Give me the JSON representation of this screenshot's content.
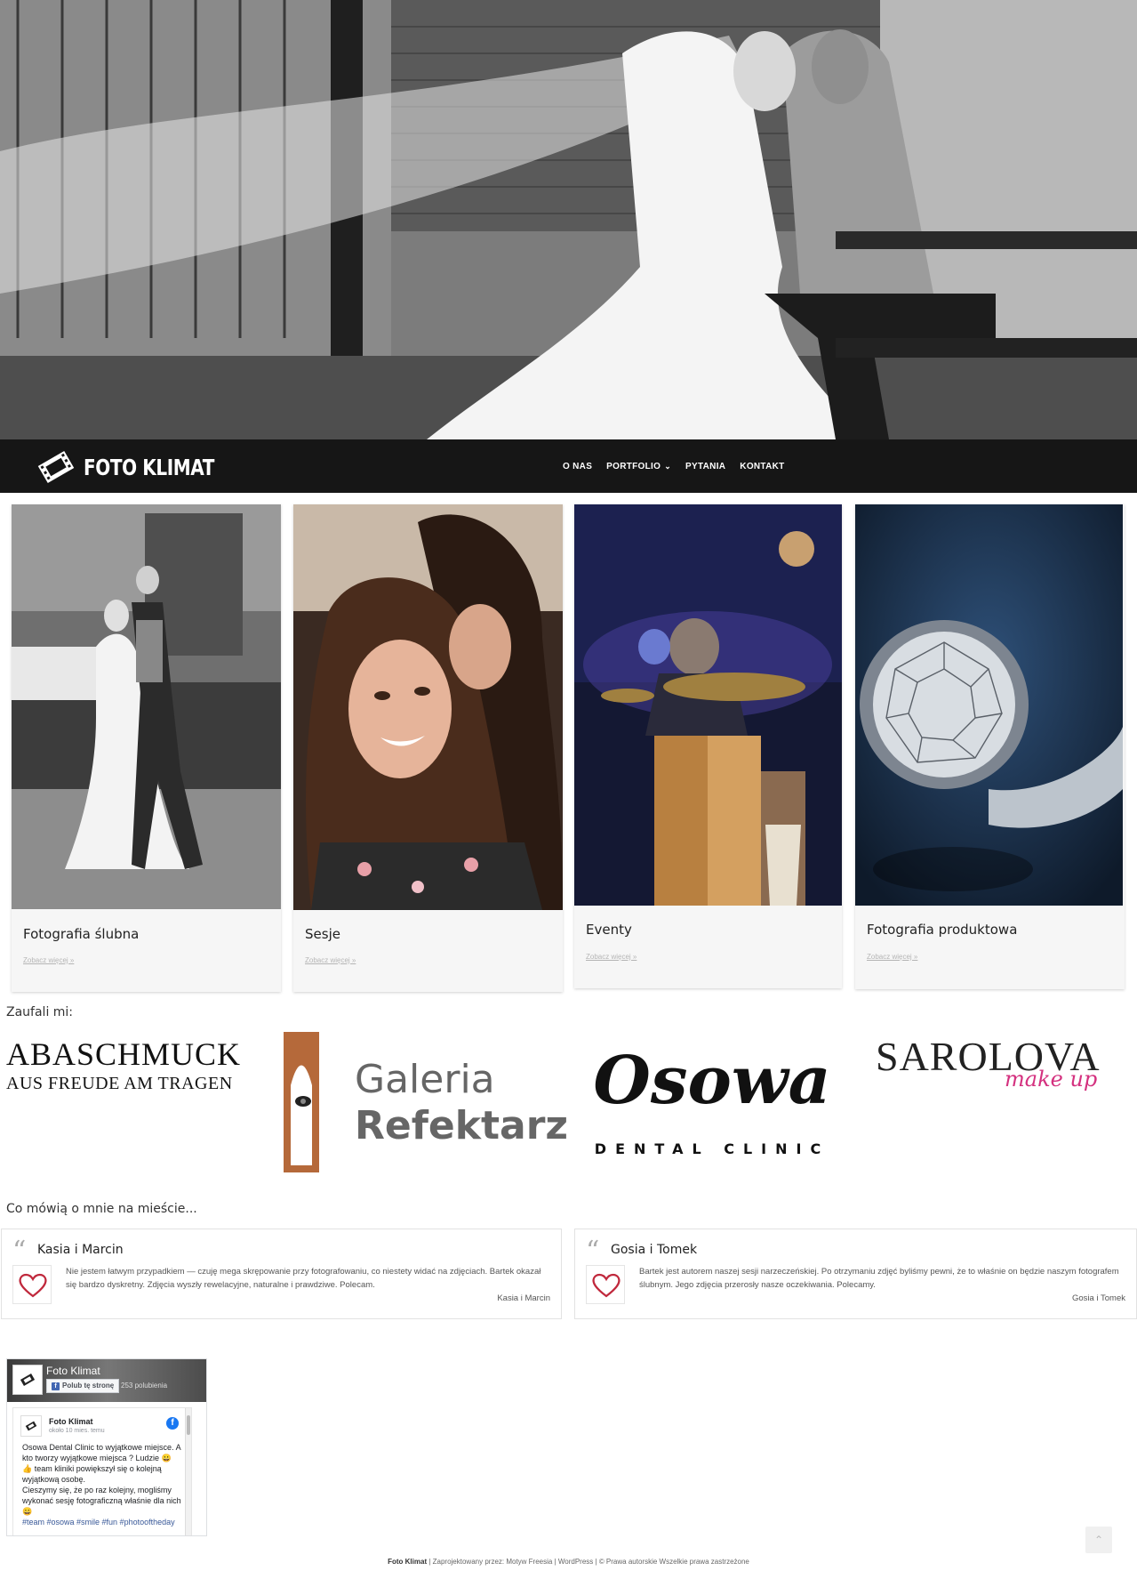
{
  "site": {
    "brand": "FOTO KLIMAT"
  },
  "nav": {
    "items": [
      {
        "label": "O NAS"
      },
      {
        "label": "PORTFOLIO"
      },
      {
        "label": "PYTANIA"
      },
      {
        "label": "KONTAKT"
      }
    ]
  },
  "portfolio": [
    {
      "title": "Fotografia ślubna",
      "link": "Zobacz więcej »"
    },
    {
      "title": "Sesje",
      "link": "Zobacz więcej »"
    },
    {
      "title": "Eventy",
      "link": "Zobacz więcej »"
    },
    {
      "title": "Fotografia produktowa",
      "link": "Zobacz więcej »"
    }
  ],
  "clients": {
    "heading": "Zaufali mi:",
    "logos": [
      {
        "line1": "ABASCHMUCK",
        "line2": "AUS FREUDE AM TRAGEN"
      },
      {
        "line1": "Galeria",
        "line2": "Refektarz"
      },
      {
        "line1": "Osowa",
        "line2": "DENTAL CLINIC"
      },
      {
        "line1": "SAROLOVA",
        "line2": "make up"
      }
    ]
  },
  "testimonials": {
    "heading": "Co mówią o mnie na mieście...",
    "items": [
      {
        "name": "Kasia i Marcin",
        "text": "Nie jestem łatwym przypadkiem — czuję mega skrępowanie przy fotografowaniu, co niestety widać na zdjęciach. Bartek okazał się bardzo dyskretny. Zdjęcia wyszły rewelacyjne, naturalne i prawdziwe. Polecam.",
        "author": "Kasia i Marcin"
      },
      {
        "name": "Gosia i Tomek",
        "text": "Bartek jest autorem naszej sesji narzeczeńskiej. Po otrzymaniu zdjęć byliśmy pewni, że to właśnie on będzie naszym fotografem ślubnym. Jego zdjęcia przerosły nasze oczekiwania. Polecamy.",
        "author": "Gosia i Tomek"
      }
    ]
  },
  "facebook": {
    "page_name": "Foto Klimat",
    "like_button": "Polub tę stronę",
    "likes": "253 polubienia",
    "post": {
      "author": "Foto Klimat",
      "time": "około 10 mies. temu",
      "text": "Osowa Dental Clinic to wyjątkowe miejsce. A kto tworzy wyjątkowe miejsca ? Ludzie 😀\n👍 team kliniki powiększył się o kolejną wyjątkową osobę.\nCieszymy się, że po raz kolejny, mogliśmy wykonać sesję fotograficzną właśnie dla nich 😀",
      "tags": "#team #osowa #smile #fun #photooftheday"
    }
  },
  "footer": {
    "brand": "Foto Klimat",
    "text": " | Zaprojektowany przez: Motyw Freesia | WordPress | © Prawa autorskie Wszelkie prawa zastrzeżone"
  },
  "colors": {
    "navbar": "#161616",
    "card_bg": "#f6f6f6",
    "heart": "#c0283c",
    "galeria_brown": "#b5693a",
    "sarolova_pink": "#d4317f"
  }
}
